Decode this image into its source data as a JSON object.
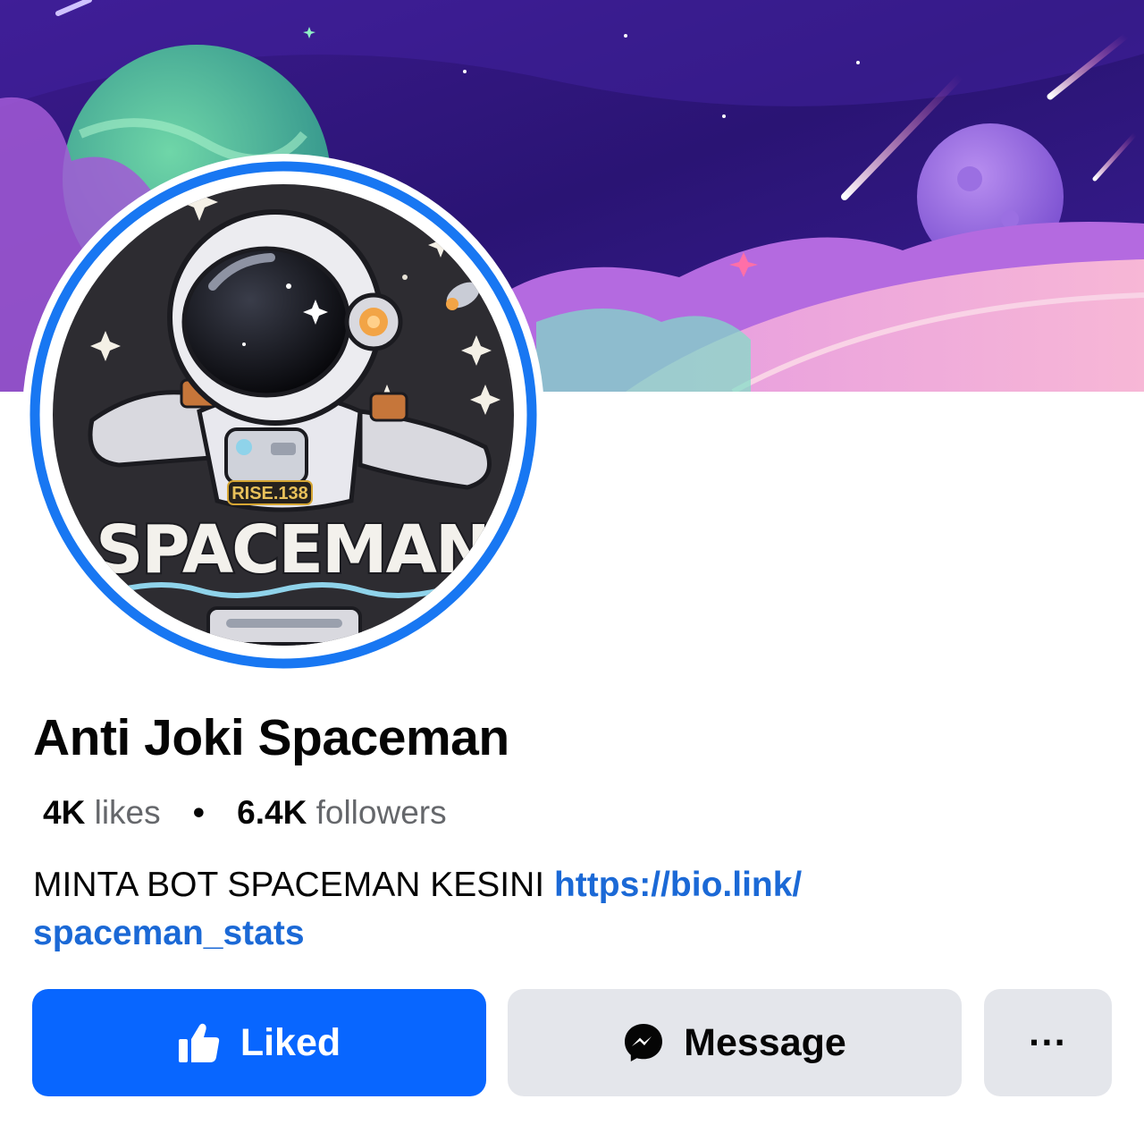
{
  "page": {
    "name": "Anti Joki Spaceman",
    "avatar_text": "SPACEMAN",
    "avatar_badge": "RISE.138"
  },
  "stats": {
    "likes_count": "4K",
    "likes_label": "likes",
    "separator": "•",
    "followers_count": "6.4K",
    "followers_label": "followers"
  },
  "bio": {
    "text": "MINTA BOT SPACEMAN KESINI ",
    "link": "https://bio.link/spaceman_stats",
    "link_line1": "https://bio.link/",
    "link_line2": "spaceman_stats"
  },
  "actions": {
    "liked_label": "Liked",
    "message_label": "Message",
    "more_label": "···"
  },
  "colors": {
    "primary_blue": "#0866ff",
    "link_blue": "#1b69d6",
    "button_gray": "#e4e6eb"
  },
  "icons": {
    "liked": "thumbs-up-icon",
    "message": "messenger-icon"
  }
}
